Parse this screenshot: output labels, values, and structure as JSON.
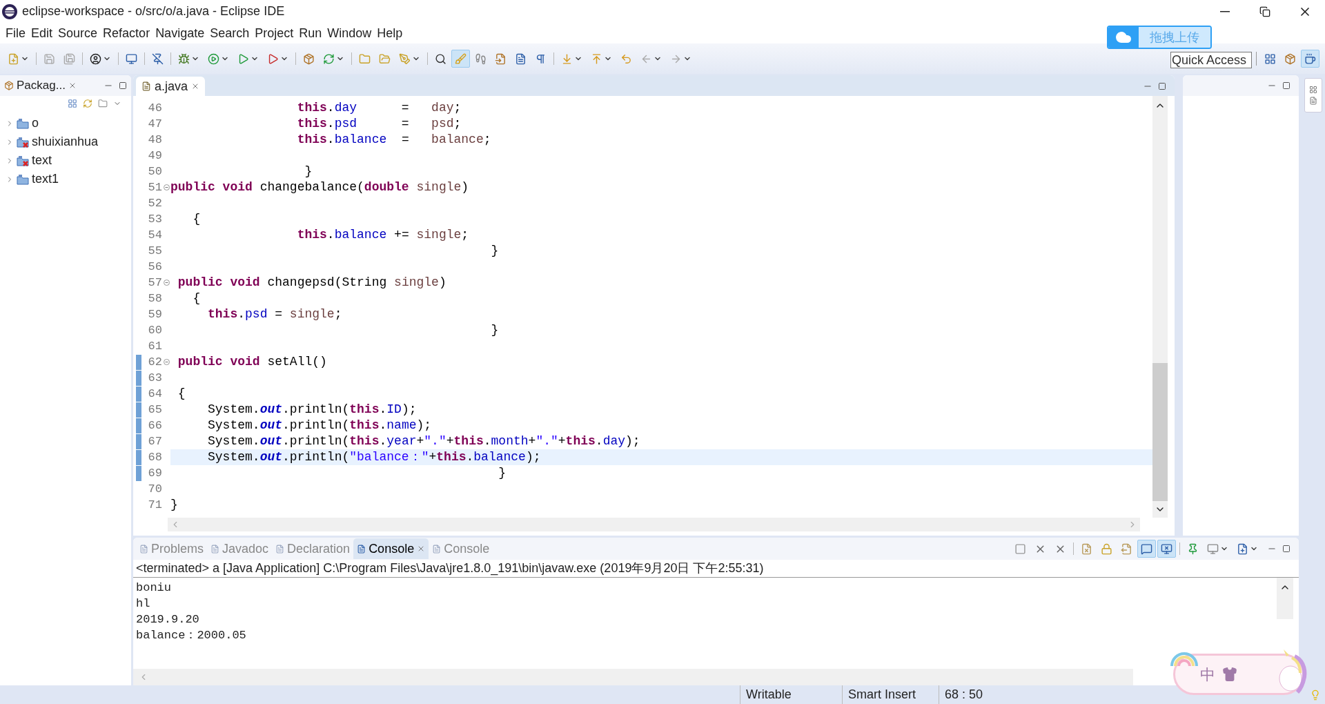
{
  "window": {
    "title": "eclipse-workspace - o/src/o/a.java - Eclipse IDE"
  },
  "menu": [
    "File",
    "Edit",
    "Source",
    "Refactor",
    "Navigate",
    "Search",
    "Project",
    "Run",
    "Window",
    "Help"
  ],
  "main_toolbar": [
    {
      "pressed": false
    },
    {
      "pressed": false
    },
    {
      "pressed": false
    },
    {
      "pressed": false
    },
    {
      "pressed": false
    },
    {
      "pressed": false
    },
    {
      "pressed": false
    },
    {
      "pressed": false
    },
    {
      "pressed": false
    },
    {
      "pressed": false
    },
    {
      "pressed": false
    },
    {
      "pressed": false
    },
    {
      "pressed": false
    },
    {
      "pressed": false
    },
    {
      "pressed": false
    },
    {
      "pressed": false
    },
    {
      "pressed": true
    },
    {
      "pressed": false
    },
    {
      "pressed": false
    },
    {
      "pressed": false
    },
    {
      "pressed": false
    },
    {
      "pressed": false
    },
    {
      "pressed": false
    },
    {
      "pressed": false
    },
    {
      "pressed": false
    },
    {
      "pressed": false
    }
  ],
  "quick_access": {
    "placeholder": "Quick Access"
  },
  "perspectives": [
    {
      "pressed": false
    },
    {
      "pressed": false
    },
    {
      "pressed": true
    }
  ],
  "upload_widget": {
    "label": "拖拽上传"
  },
  "package_explorer": {
    "tab": "Packag...",
    "items": [
      {
        "label": "o",
        "expanded": false,
        "error": false
      },
      {
        "label": "shuixianhua",
        "expanded": false,
        "error": true
      },
      {
        "label": "text",
        "expanded": false,
        "error": true
      },
      {
        "label": "text1",
        "expanded": false,
        "error": false
      }
    ]
  },
  "editor": {
    "tab": "a.java",
    "lines": [
      {
        "number": "46",
        "marked": false,
        "current": false,
        "fold": false,
        "segments": [
          {
            "kind": "keyword",
            "text": "                 this"
          },
          {
            "kind": "plain",
            "text": "."
          },
          {
            "kind": "field",
            "text": "day"
          },
          {
            "kind": "plain",
            "text": "      =   "
          },
          {
            "kind": "param",
            "text": "day"
          },
          {
            "kind": "plain",
            "text": ";"
          }
        ]
      },
      {
        "number": "47",
        "marked": false,
        "current": false,
        "fold": false,
        "segments": [
          {
            "kind": "keyword",
            "text": "                 this"
          },
          {
            "kind": "plain",
            "text": "."
          },
          {
            "kind": "field",
            "text": "psd"
          },
          {
            "kind": "plain",
            "text": "      =   "
          },
          {
            "kind": "param",
            "text": "psd"
          },
          {
            "kind": "plain",
            "text": ";"
          }
        ]
      },
      {
        "number": "48",
        "marked": false,
        "current": false,
        "fold": false,
        "segments": [
          {
            "kind": "keyword",
            "text": "                 this"
          },
          {
            "kind": "plain",
            "text": "."
          },
          {
            "kind": "field",
            "text": "balance"
          },
          {
            "kind": "plain",
            "text": "  =   "
          },
          {
            "kind": "param",
            "text": "balance"
          },
          {
            "kind": "plain",
            "text": ";"
          }
        ]
      },
      {
        "number": "49",
        "marked": false,
        "current": false,
        "fold": false
      },
      {
        "number": "50",
        "marked": false,
        "current": false,
        "fold": false,
        "segments": [
          {
            "kind": "plain",
            "text": "                  }"
          }
        ]
      },
      {
        "number": "51",
        "marked": false,
        "current": false,
        "fold": true,
        "segments": [
          {
            "kind": "keyword",
            "text": "public"
          },
          {
            "kind": "keyword",
            "text": " void"
          },
          {
            "kind": "plain",
            "text": " changebalance("
          },
          {
            "kind": "keyword",
            "text": "double"
          },
          {
            "kind": "param",
            "text": " single"
          },
          {
            "kind": "plain",
            "text": ")"
          }
        ]
      },
      {
        "number": "52",
        "marked": false,
        "current": false,
        "fold": false
      },
      {
        "number": "53",
        "marked": false,
        "current": false,
        "fold": false,
        "segments": [
          {
            "kind": "plain",
            "text": "   {"
          }
        ]
      },
      {
        "number": "54",
        "marked": false,
        "current": false,
        "fold": false,
        "segments": [
          {
            "kind": "keyword",
            "text": "                 this"
          },
          {
            "kind": "plain",
            "text": "."
          },
          {
            "kind": "field",
            "text": "balance"
          },
          {
            "kind": "plain",
            "text": " += "
          },
          {
            "kind": "param",
            "text": "single"
          },
          {
            "kind": "plain",
            "text": ";"
          }
        ]
      },
      {
        "number": "55",
        "marked": false,
        "current": false,
        "fold": false,
        "segments": [
          {
            "kind": "plain",
            "text": "                                           }"
          }
        ]
      },
      {
        "number": "56",
        "marked": false,
        "current": false,
        "fold": false
      },
      {
        "number": "57",
        "marked": false,
        "current": false,
        "fold": true,
        "segments": [
          {
            "kind": "keyword",
            "text": " public"
          },
          {
            "kind": "keyword",
            "text": " void"
          },
          {
            "kind": "plain",
            "text": " changepsd(String "
          },
          {
            "kind": "param",
            "text": "single"
          },
          {
            "kind": "plain",
            "text": ")"
          }
        ]
      },
      {
        "number": "58",
        "marked": false,
        "current": false,
        "fold": false,
        "segments": [
          {
            "kind": "plain",
            "text": "   {"
          }
        ]
      },
      {
        "number": "59",
        "marked": false,
        "current": false,
        "fold": false,
        "segments": [
          {
            "kind": "keyword",
            "text": "     this"
          },
          {
            "kind": "plain",
            "text": "."
          },
          {
            "kind": "field",
            "text": "psd"
          },
          {
            "kind": "plain",
            "text": " = "
          },
          {
            "kind": "param",
            "text": "single"
          },
          {
            "kind": "plain",
            "text": ";"
          }
        ]
      },
      {
        "number": "60",
        "marked": false,
        "current": false,
        "fold": false,
        "segments": [
          {
            "kind": "plain",
            "text": "                                           }"
          }
        ]
      },
      {
        "number": "61",
        "marked": false,
        "current": false,
        "fold": false
      },
      {
        "number": "62",
        "marked": true,
        "current": false,
        "fold": true,
        "segments": [
          {
            "kind": "keyword",
            "text": " public"
          },
          {
            "kind": "keyword",
            "text": " void"
          },
          {
            "kind": "plain",
            "text": " setAll()"
          }
        ]
      },
      {
        "number": "63",
        "marked": true,
        "current": false,
        "fold": false
      },
      {
        "number": "64",
        "marked": true,
        "current": false,
        "fold": false,
        "segments": [
          {
            "kind": "plain",
            "text": " {"
          }
        ]
      },
      {
        "number": "65",
        "marked": true,
        "current": false,
        "fold": false,
        "segments": [
          {
            "kind": "plain",
            "text": "     System."
          },
          {
            "kind": "static",
            "text": "out"
          },
          {
            "kind": "plain",
            "text": ".println("
          },
          {
            "kind": "keyword",
            "text": "this"
          },
          {
            "kind": "plain",
            "text": "."
          },
          {
            "kind": "field",
            "text": "ID"
          },
          {
            "kind": "plain",
            "text": ");"
          }
        ]
      },
      {
        "number": "66",
        "marked": true,
        "current": false,
        "fold": false,
        "segments": [
          {
            "kind": "plain",
            "text": "     System."
          },
          {
            "kind": "static",
            "text": "out"
          },
          {
            "kind": "plain",
            "text": ".println("
          },
          {
            "kind": "keyword",
            "text": "this"
          },
          {
            "kind": "plain",
            "text": "."
          },
          {
            "kind": "field",
            "text": "name"
          },
          {
            "kind": "plain",
            "text": ");"
          }
        ]
      },
      {
        "number": "67",
        "marked": true,
        "current": false,
        "fold": false,
        "segments": [
          {
            "kind": "plain",
            "text": "     System."
          },
          {
            "kind": "static",
            "text": "out"
          },
          {
            "kind": "plain",
            "text": ".println("
          },
          {
            "kind": "keyword",
            "text": "this"
          },
          {
            "kind": "plain",
            "text": "."
          },
          {
            "kind": "field",
            "text": "year"
          },
          {
            "kind": "plain",
            "text": "+"
          },
          {
            "kind": "string",
            "text": "\".\""
          },
          {
            "kind": "plain",
            "text": "+"
          },
          {
            "kind": "keyword",
            "text": "this"
          },
          {
            "kind": "plain",
            "text": "."
          },
          {
            "kind": "field",
            "text": "month"
          },
          {
            "kind": "plain",
            "text": "+"
          },
          {
            "kind": "string",
            "text": "\".\""
          },
          {
            "kind": "plain",
            "text": "+"
          },
          {
            "kind": "keyword",
            "text": "this"
          },
          {
            "kind": "plain",
            "text": "."
          },
          {
            "kind": "field",
            "text": "day"
          },
          {
            "kind": "plain",
            "text": ");"
          }
        ]
      },
      {
        "number": "68",
        "marked": true,
        "current": true,
        "fold": false,
        "segments": [
          {
            "kind": "plain",
            "text": "     System."
          },
          {
            "kind": "static",
            "text": "out"
          },
          {
            "kind": "plain",
            "text": ".println("
          },
          {
            "kind": "string",
            "text": "\"balance：\""
          },
          {
            "kind": "plain",
            "text": "+"
          },
          {
            "kind": "keyword",
            "text": "this"
          },
          {
            "kind": "plain",
            "text": "."
          },
          {
            "kind": "field",
            "text": "balance"
          },
          {
            "kind": "plain",
            "text": ");"
          }
        ]
      },
      {
        "number": "69",
        "marked": true,
        "current": false,
        "fold": false,
        "segments": [
          {
            "kind": "plain",
            "text": "                                            }"
          }
        ]
      },
      {
        "number": "70",
        "marked": false,
        "current": false,
        "fold": false
      },
      {
        "number": "71",
        "marked": false,
        "current": false,
        "fold": false,
        "segments": [
          {
            "kind": "plain",
            "text": "}"
          }
        ]
      }
    ]
  },
  "bottom_panel": {
    "tabs": [
      {
        "label": "Problems",
        "selected": false,
        "closable": false
      },
      {
        "label": "Javadoc",
        "selected": false,
        "closable": false
      },
      {
        "label": "Declaration",
        "selected": false,
        "closable": false
      },
      {
        "label": "Console",
        "selected": true,
        "closable": true
      },
      {
        "label": "Console",
        "selected": false,
        "closable": false
      }
    ],
    "toolbar": [
      {
        "pressed": false
      },
      {
        "pressed": false
      },
      {
        "pressed": false
      },
      {
        "pressed": false
      },
      {
        "pressed": false
      },
      {
        "pressed": false
      },
      {
        "pressed": true
      },
      {
        "pressed": true
      },
      {
        "pressed": false
      },
      {
        "pressed": false
      },
      {
        "pressed": false
      }
    ],
    "description": "<terminated> a [Java Application] C:\\Program Files\\Java\\jre1.8.0_191\\bin\\javaw.exe (2019年9月20日 下午2:55:31)",
    "output": [
      "boniu",
      "hl",
      "2019.9.20",
      "balance：2000.05"
    ]
  },
  "ime_widget": {
    "mode": "中"
  },
  "status_bar": [
    "Writable",
    "Smart Insert",
    "68 : 50"
  ]
}
